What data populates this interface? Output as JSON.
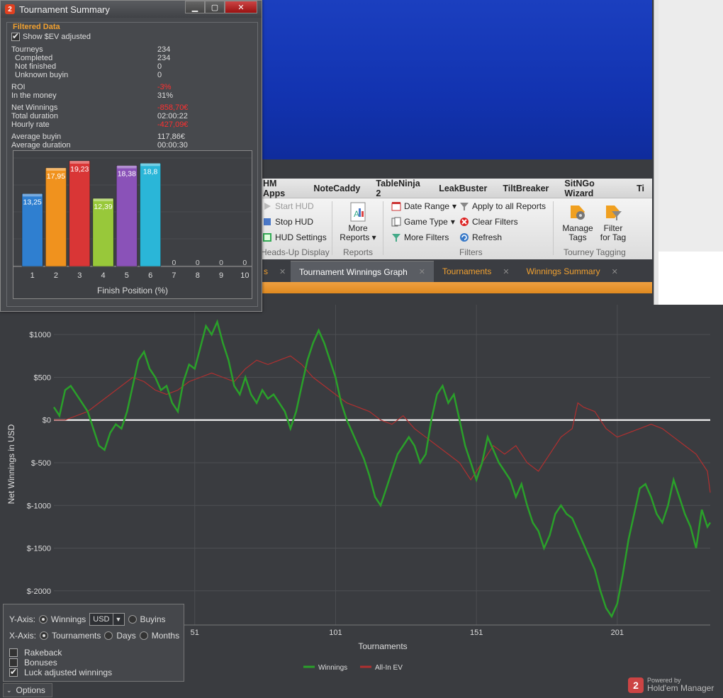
{
  "summary": {
    "title": "Tournament Summary",
    "filtered_label": "Filtered Data",
    "show_ev_label": "Show $EV adjusted",
    "stats": [
      {
        "label": "Tourneys",
        "value": "234"
      },
      {
        "label": "Completed",
        "value": "234"
      },
      {
        "label": "Not finished",
        "value": "0"
      },
      {
        "label": "Unknown buyin",
        "value": "0"
      },
      {
        "label": "ROI",
        "value": "-3%"
      },
      {
        "label": "In the money",
        "value": "31%"
      },
      {
        "label": "Net Winnings",
        "value": "-858,70€"
      },
      {
        "label": "Total duration",
        "value": "02:00:22"
      },
      {
        "label": "Hourly rate",
        "value": "-427,09€"
      },
      {
        "label": "Average buyin",
        "value": "117,86€"
      },
      {
        "label": "Average duration",
        "value": "00:00:30"
      }
    ],
    "bar_chart": {
      "type": "bar",
      "categories": [
        "1",
        "2",
        "3",
        "4",
        "5",
        "6",
        "7",
        "8",
        "9",
        "10"
      ],
      "values": [
        13.25,
        17.95,
        19.23,
        12.39,
        18.38,
        18.8,
        0,
        0,
        0,
        0
      ],
      "value_labels": [
        "13,25",
        "17,95",
        "19,23",
        "12,39",
        "18,38",
        "18,8",
        "0",
        "0",
        "0",
        "0"
      ],
      "colors": [
        "#2f7fd0",
        "#f0921e",
        "#d93636",
        "#98c83a",
        "#8a52b8",
        "#2ab6d8",
        "#888",
        "#888",
        "#888",
        "#888"
      ],
      "xlabel": "Finish Position (%)"
    },
    "window_buttons": {
      "minimize": "▁",
      "maximize": "▢",
      "close": "✕"
    }
  },
  "menubar": [
    "HM Apps",
    "NoteCaddy",
    "TableNinja 2",
    "LeakBuster",
    "TiltBreaker",
    "SitNGo Wizard",
    "Ti"
  ],
  "ribbon": {
    "hud": {
      "start": "Start HUD",
      "stop": "Stop HUD",
      "settings": "HUD Settings",
      "group": "Heads-Up Display"
    },
    "reports": {
      "more": "More",
      "reports": "Reports",
      "group": "Reports"
    },
    "filters": {
      "date_range": "Date Range",
      "game_type": "Game Type",
      "more_filters": "More Filters",
      "apply_all": "Apply to all Reports",
      "clear": "Clear Filters",
      "refresh": "Refresh",
      "group": "Filters"
    },
    "tagging": {
      "manage1": "Manage",
      "manage2": "Tags",
      "filter1": "Filter",
      "filter2": "for Tag",
      "group": "Tourney Tagging"
    }
  },
  "tabs": [
    {
      "label": "Tournament Winnings Graph",
      "active": true
    },
    {
      "label": "Tournaments",
      "active": false
    },
    {
      "label": "Winnings Summary",
      "active": false
    }
  ],
  "partial_tab": "s",
  "options": {
    "yaxis_label": "Y-Axis:",
    "winnings": "Winnings",
    "currency": "USD",
    "buyins": "Buyins",
    "xaxis_label": "X-Axis:",
    "tournaments": "Tournaments",
    "days": "Days",
    "months": "Months",
    "rakeback": "Rakeback",
    "bonuses": "Bonuses",
    "luck": "Luck adjusted winnings",
    "toggle": "Options"
  },
  "logo": {
    "powered": "Powered by",
    "name": "Hold'em Manager"
  },
  "chart_data": {
    "type": "line",
    "xlabel": "Tournaments",
    "ylabel": "Net Winnings in USD",
    "xticks": [
      51,
      101,
      151,
      201
    ],
    "yticks": [
      1000,
      500,
      0,
      -500,
      -1000,
      -1500,
      -2000
    ],
    "ytick_labels": [
      "$1000",
      "$500",
      "$0",
      "$-500",
      "$-1000",
      "$-1500",
      "$-2000"
    ],
    "xlim": [
      1,
      234
    ],
    "ylim": [
      -2400,
      1350
    ],
    "series": [
      {
        "name": "Winnings",
        "color": "#2aa02a",
        "points": [
          [
            1,
            150
          ],
          [
            3,
            50
          ],
          [
            5,
            350
          ],
          [
            7,
            400
          ],
          [
            10,
            250
          ],
          [
            13,
            100
          ],
          [
            15,
            -100
          ],
          [
            17,
            -300
          ],
          [
            19,
            -350
          ],
          [
            21,
            -150
          ],
          [
            23,
            -50
          ],
          [
            25,
            -100
          ],
          [
            27,
            100
          ],
          [
            29,
            400
          ],
          [
            31,
            700
          ],
          [
            33,
            800
          ],
          [
            35,
            600
          ],
          [
            37,
            500
          ],
          [
            39,
            350
          ],
          [
            41,
            400
          ],
          [
            43,
            200
          ],
          [
            45,
            100
          ],
          [
            47,
            450
          ],
          [
            49,
            650
          ],
          [
            51,
            600
          ],
          [
            53,
            850
          ],
          [
            55,
            1100
          ],
          [
            57,
            1000
          ],
          [
            59,
            1150
          ],
          [
            61,
            900
          ],
          [
            63,
            700
          ],
          [
            65,
            400
          ],
          [
            67,
            300
          ],
          [
            69,
            500
          ],
          [
            71,
            300
          ],
          [
            73,
            200
          ],
          [
            75,
            350
          ],
          [
            77,
            250
          ],
          [
            79,
            300
          ],
          [
            81,
            200
          ],
          [
            83,
            100
          ],
          [
            85,
            -100
          ],
          [
            87,
            100
          ],
          [
            89,
            400
          ],
          [
            91,
            700
          ],
          [
            93,
            900
          ],
          [
            95,
            1050
          ],
          [
            97,
            900
          ],
          [
            99,
            700
          ],
          [
            101,
            500
          ],
          [
            103,
            200
          ],
          [
            105,
            0
          ],
          [
            107,
            -150
          ],
          [
            109,
            -300
          ],
          [
            111,
            -450
          ],
          [
            113,
            -650
          ],
          [
            115,
            -900
          ],
          [
            117,
            -1000
          ],
          [
            119,
            -800
          ],
          [
            121,
            -600
          ],
          [
            123,
            -400
          ],
          [
            125,
            -300
          ],
          [
            127,
            -200
          ],
          [
            129,
            -300
          ],
          [
            131,
            -500
          ],
          [
            133,
            -400
          ],
          [
            135,
            0
          ],
          [
            137,
            300
          ],
          [
            139,
            400
          ],
          [
            141,
            200
          ],
          [
            143,
            300
          ],
          [
            145,
            0
          ],
          [
            147,
            -300
          ],
          [
            149,
            -500
          ],
          [
            151,
            -700
          ],
          [
            153,
            -500
          ],
          [
            155,
            -200
          ],
          [
            157,
            -350
          ],
          [
            159,
            -500
          ],
          [
            161,
            -600
          ],
          [
            163,
            -700
          ],
          [
            165,
            -900
          ],
          [
            167,
            -750
          ],
          [
            169,
            -1000
          ],
          [
            171,
            -1200
          ],
          [
            173,
            -1300
          ],
          [
            175,
            -1500
          ],
          [
            177,
            -1350
          ],
          [
            179,
            -1100
          ],
          [
            181,
            -1000
          ],
          [
            183,
            -1100
          ],
          [
            185,
            -1150
          ],
          [
            187,
            -1300
          ],
          [
            189,
            -1450
          ],
          [
            191,
            -1600
          ],
          [
            193,
            -1750
          ],
          [
            195,
            -2000
          ],
          [
            197,
            -2200
          ],
          [
            199,
            -2300
          ],
          [
            201,
            -2150
          ],
          [
            203,
            -1800
          ],
          [
            205,
            -1400
          ],
          [
            207,
            -1100
          ],
          [
            209,
            -800
          ],
          [
            211,
            -750
          ],
          [
            213,
            -900
          ],
          [
            215,
            -1100
          ],
          [
            217,
            -1200
          ],
          [
            219,
            -1000
          ],
          [
            221,
            -700
          ],
          [
            223,
            -900
          ],
          [
            225,
            -1100
          ],
          [
            227,
            -1250
          ],
          [
            229,
            -1500
          ],
          [
            231,
            -1050
          ],
          [
            233,
            -1250
          ],
          [
            234,
            -1200
          ]
        ]
      },
      {
        "name": "All-In EV",
        "color": "#b03030",
        "points": [
          [
            1,
            0
          ],
          [
            5,
            0
          ],
          [
            9,
            50
          ],
          [
            13,
            100
          ],
          [
            17,
            200
          ],
          [
            21,
            300
          ],
          [
            25,
            400
          ],
          [
            29,
            500
          ],
          [
            33,
            450
          ],
          [
            37,
            350
          ],
          [
            41,
            300
          ],
          [
            45,
            350
          ],
          [
            49,
            450
          ],
          [
            53,
            500
          ],
          [
            57,
            550
          ],
          [
            61,
            500
          ],
          [
            65,
            450
          ],
          [
            69,
            600
          ],
          [
            73,
            700
          ],
          [
            77,
            650
          ],
          [
            81,
            700
          ],
          [
            85,
            750
          ],
          [
            89,
            650
          ],
          [
            93,
            500
          ],
          [
            97,
            400
          ],
          [
            101,
            300
          ],
          [
            105,
            200
          ],
          [
            109,
            150
          ],
          [
            113,
            100
          ],
          [
            117,
            0
          ],
          [
            121,
            -50
          ],
          [
            125,
            50
          ],
          [
            129,
            -100
          ],
          [
            133,
            -200
          ],
          [
            137,
            -300
          ],
          [
            141,
            -400
          ],
          [
            145,
            -500
          ],
          [
            149,
            -700
          ],
          [
            153,
            -500
          ],
          [
            157,
            -300
          ],
          [
            161,
            -400
          ],
          [
            165,
            -300
          ],
          [
            169,
            -500
          ],
          [
            173,
            -600
          ],
          [
            177,
            -400
          ],
          [
            181,
            -200
          ],
          [
            185,
            -100
          ],
          [
            187,
            200
          ],
          [
            189,
            150
          ],
          [
            193,
            100
          ],
          [
            197,
            -100
          ],
          [
            201,
            -200
          ],
          [
            205,
            -150
          ],
          [
            209,
            -100
          ],
          [
            213,
            -50
          ],
          [
            217,
            -100
          ],
          [
            221,
            -200
          ],
          [
            225,
            -300
          ],
          [
            229,
            -400
          ],
          [
            231,
            -500
          ],
          [
            233,
            -600
          ],
          [
            234,
            -850
          ]
        ]
      }
    ],
    "legend": [
      "Winnings",
      "All-In EV"
    ]
  }
}
